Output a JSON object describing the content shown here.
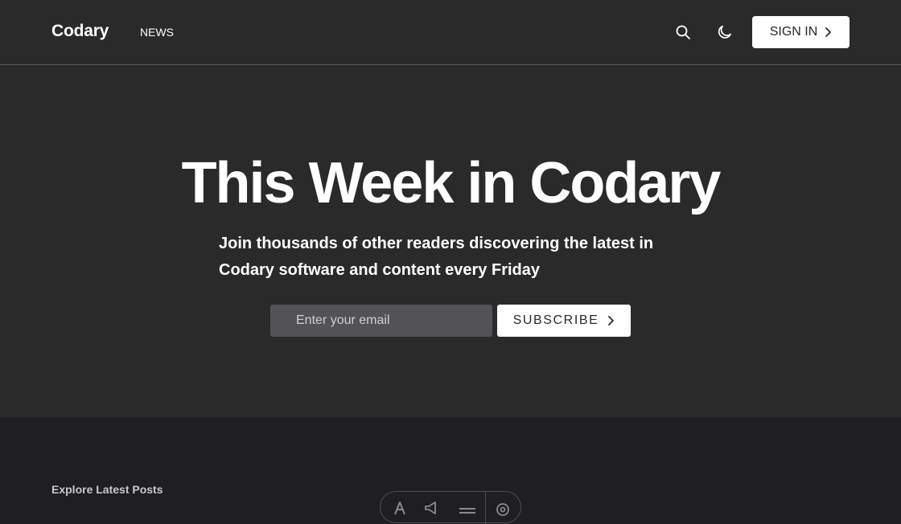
{
  "header": {
    "brand": "Codary",
    "nav": [
      {
        "label": "NEWS"
      }
    ],
    "icons": {
      "search": "search-icon",
      "theme": "moon-icon"
    },
    "signin_label": "SIGN IN"
  },
  "hero": {
    "title": "This Week in Codary",
    "subtitle_line1": "Join thousands of other readers discovering the latest in",
    "subtitle_line2": "Codary software and content every Friday",
    "email_placeholder": "Enter your email",
    "subscribe_label": "SUBSCRIBE"
  },
  "posts": {
    "section_label": "Explore Latest Posts",
    "toolbar_icons": [
      "text-icon",
      "megaphone-icon",
      "list-icon",
      "gear-icon"
    ]
  },
  "colors": {
    "header_bg": "#2a2a2b",
    "page_bg": "#1f1f21",
    "accent": "#ffffff",
    "input_bg": "#535355"
  }
}
